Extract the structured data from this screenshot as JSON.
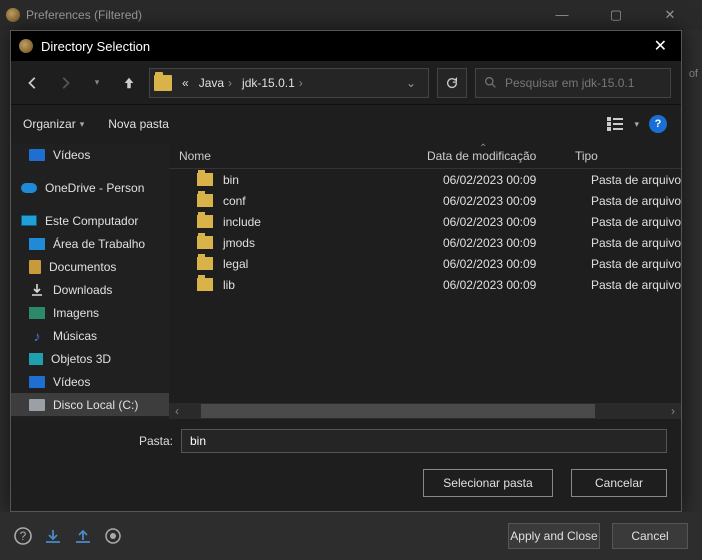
{
  "outer": {
    "title": "Preferences (Filtered)",
    "stray": "of"
  },
  "modal": {
    "title": "Directory Selection",
    "breadcrumb": {
      "pre": "«",
      "seg1": "Java",
      "seg2": "jdk-15.0.1"
    },
    "search": {
      "placeholder": "Pesquisar em jdk-15.0.1"
    },
    "toolbar": {
      "organize": "Organizar",
      "newfolder": "Nova pasta"
    },
    "tree": {
      "items": [
        {
          "label": "Vídeos",
          "icon": "video"
        },
        {
          "label": "OneDrive - Person",
          "icon": "onedrive"
        },
        {
          "label": "Este Computador",
          "icon": "pc"
        },
        {
          "label": "Área de Trabalho",
          "icon": "desk"
        },
        {
          "label": "Documentos",
          "icon": "doc"
        },
        {
          "label": "Downloads",
          "icon": "dl"
        },
        {
          "label": "Imagens",
          "icon": "img"
        },
        {
          "label": "Músicas",
          "icon": "music"
        },
        {
          "label": "Objetos 3D",
          "icon": "3d"
        },
        {
          "label": "Vídeos",
          "icon": "video"
        },
        {
          "label": "Disco Local (C:)",
          "icon": "disk"
        }
      ]
    },
    "columns": {
      "name": "Nome",
      "date": "Data de modificação",
      "type": "Tipo"
    },
    "rows": [
      {
        "name": "bin",
        "date": "06/02/2023 00:09",
        "type": "Pasta de arquivo"
      },
      {
        "name": "conf",
        "date": "06/02/2023 00:09",
        "type": "Pasta de arquivo"
      },
      {
        "name": "include",
        "date": "06/02/2023 00:09",
        "type": "Pasta de arquivo"
      },
      {
        "name": "jmods",
        "date": "06/02/2023 00:09",
        "type": "Pasta de arquivo"
      },
      {
        "name": "legal",
        "date": "06/02/2023 00:09",
        "type": "Pasta de arquivo"
      },
      {
        "name": "lib",
        "date": "06/02/2023 00:09",
        "type": "Pasta de arquivo"
      }
    ],
    "footer": {
      "folder_label": "Pasta:",
      "folder_value": "bin",
      "select": "Selecionar pasta",
      "cancel": "Cancelar"
    }
  },
  "pref_footer": {
    "apply_close": "Apply and Close",
    "cancel": "Cancel"
  }
}
